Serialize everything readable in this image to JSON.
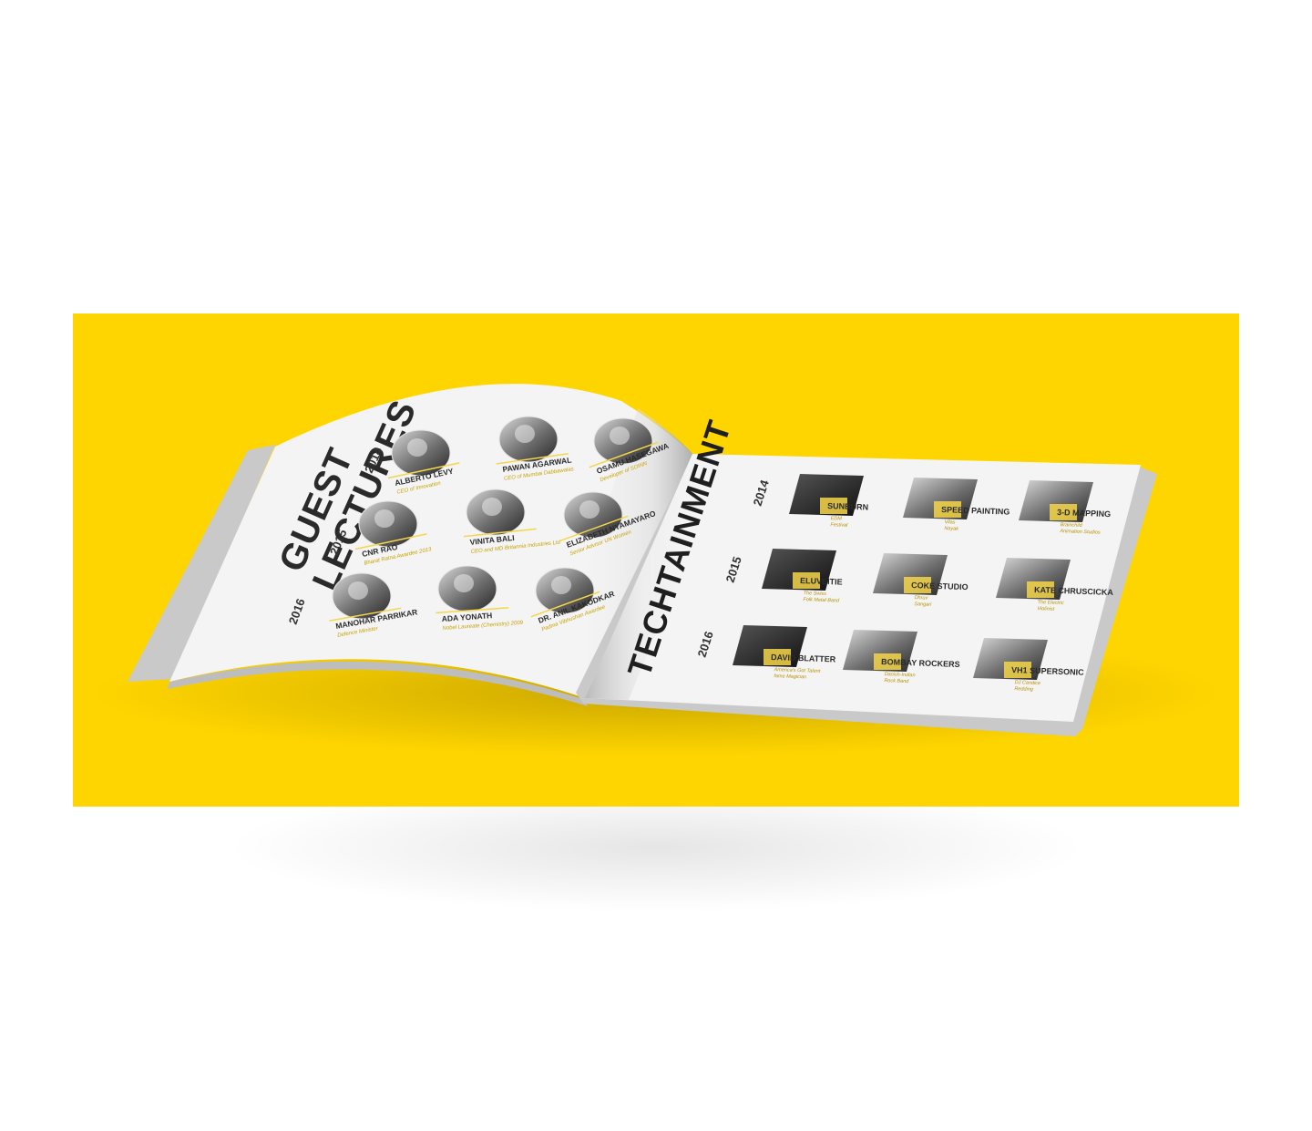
{
  "colors": {
    "background": "#ffffff",
    "panel": "#ffd500",
    "accent": "#f5d64a",
    "page": "#f4f4f4",
    "cover": "#c9c9c9",
    "ink": "#2a2a2a"
  },
  "left_page": {
    "title_line1": "GUEST",
    "title_line2": "LECTURES",
    "years": [
      "2014",
      "2015",
      "2016"
    ],
    "rows": [
      [
        {
          "name": "ALBERTO LEVY",
          "sub": "CEO of Innovation"
        },
        {
          "name": "PAWAN AGARWAL",
          "sub": "CEO of Mumbai Dabbawalas"
        },
        {
          "name": "OSAMU HASEGAWA",
          "sub": "Developer of SOINN"
        }
      ],
      [
        {
          "name": "CNR RAO",
          "sub": "Bharat Ratna Awardee 2013"
        },
        {
          "name": "VINITA BALI",
          "sub": "CEO and MD Britannia Industries Ltd"
        },
        {
          "name": "ELIZABETH NYAMAYARO",
          "sub": "Senior Advisor UN Women"
        }
      ],
      [
        {
          "name": "MANOHAR PARRIKAR",
          "sub": "Defence Minister"
        },
        {
          "name": "ADA YONATH",
          "sub": "Nobel Laureate (Chemistry) 2009"
        },
        {
          "name": "DR. ANIL KAKODKAR",
          "sub": "Padma Vibhushan Awardee"
        }
      ]
    ]
  },
  "right_page": {
    "title": "TECHTAINMENT",
    "years": [
      "2014",
      "2015",
      "2016"
    ],
    "rows": [
      [
        {
          "name": "SUNBURN",
          "sub1": "EDM",
          "sub2": "Festival"
        },
        {
          "name": "SPEED PAINTING",
          "sub1": "Vilas",
          "sub2": "Nayak"
        },
        {
          "name": "3-D MAPPING",
          "sub1": "Brainchild",
          "sub2": "Animation Studios"
        }
      ],
      [
        {
          "name": "ELUVEITIE",
          "sub1": "The Swiss",
          "sub2": "Folk Metal Band"
        },
        {
          "name": "COKE STUDIO",
          "sub1": "Dhruv",
          "sub2": "Sangari"
        },
        {
          "name": "KATE CHRUSCICKA",
          "sub1": "The Electric",
          "sub2": "Violinist"
        }
      ],
      [
        {
          "name": "DAVID BLATTER",
          "sub1": "America's Got Talent",
          "sub2": "fame Magician"
        },
        {
          "name": "BOMBAY ROCKERS",
          "sub1": "Danish-Indian",
          "sub2": "Rock Band"
        },
        {
          "name": "VH1 SUPERSONIC",
          "sub1": "DJ Candice",
          "sub2": "Redding"
        }
      ]
    ]
  }
}
